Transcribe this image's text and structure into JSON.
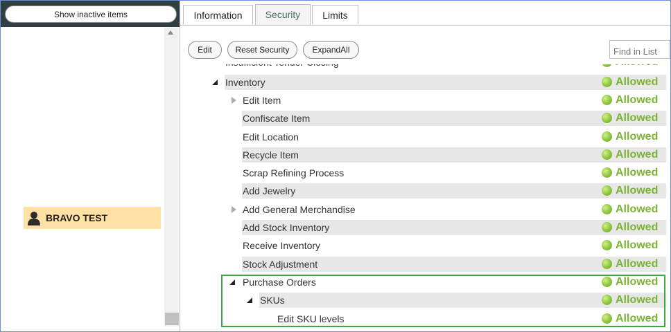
{
  "left_panel": {
    "show_inactive_label": "Show inactive items",
    "users": [
      {
        "name": "BRAVO TEST",
        "selected": true
      }
    ]
  },
  "tabs": [
    {
      "label": "Information",
      "active": false
    },
    {
      "label": "Security",
      "active": true
    },
    {
      "label": "Limits",
      "active": false
    }
  ],
  "toolbar": {
    "edit_label": "Edit",
    "reset_security_label": "Reset Security",
    "expand_all_label": "ExpandAll",
    "find_placeholder": "Find in List"
  },
  "tree": {
    "status_color": "#7cb334",
    "rows": [
      {
        "label": "Insufficient Tender Closing",
        "level": 0,
        "expander": "none",
        "status": "Allowed"
      },
      {
        "label": "Inventory",
        "level": 0,
        "expander": "expanded",
        "status": "Allowed"
      },
      {
        "label": "Edit Item",
        "level": 1,
        "expander": "collapsed",
        "status": "Allowed"
      },
      {
        "label": "Confiscate Item",
        "level": 1,
        "expander": "none",
        "status": "Allowed"
      },
      {
        "label": "Edit Location",
        "level": 1,
        "expander": "none",
        "status": "Allowed"
      },
      {
        "label": "Recycle Item",
        "level": 1,
        "expander": "none",
        "status": "Allowed"
      },
      {
        "label": "Scrap Refining Process",
        "level": 1,
        "expander": "none",
        "status": "Allowed"
      },
      {
        "label": "Add Jewelry",
        "level": 1,
        "expander": "none",
        "status": "Allowed"
      },
      {
        "label": "Add General Merchandise",
        "level": 1,
        "expander": "collapsed",
        "status": "Allowed"
      },
      {
        "label": "Add Stock Inventory",
        "level": 1,
        "expander": "none",
        "status": "Allowed"
      },
      {
        "label": "Receive Inventory",
        "level": 1,
        "expander": "none",
        "status": "Allowed"
      },
      {
        "label": "Stock Adjustment",
        "level": 1,
        "expander": "none",
        "status": "Allowed"
      },
      {
        "label": "Purchase Orders",
        "level": 1,
        "expander": "expanded",
        "status": "Allowed"
      },
      {
        "label": "SKUs",
        "level": 2,
        "expander": "expanded",
        "status": "Allowed"
      },
      {
        "label": "Edit SKU levels",
        "level": 3,
        "expander": "none",
        "status": "Allowed"
      }
    ]
  }
}
